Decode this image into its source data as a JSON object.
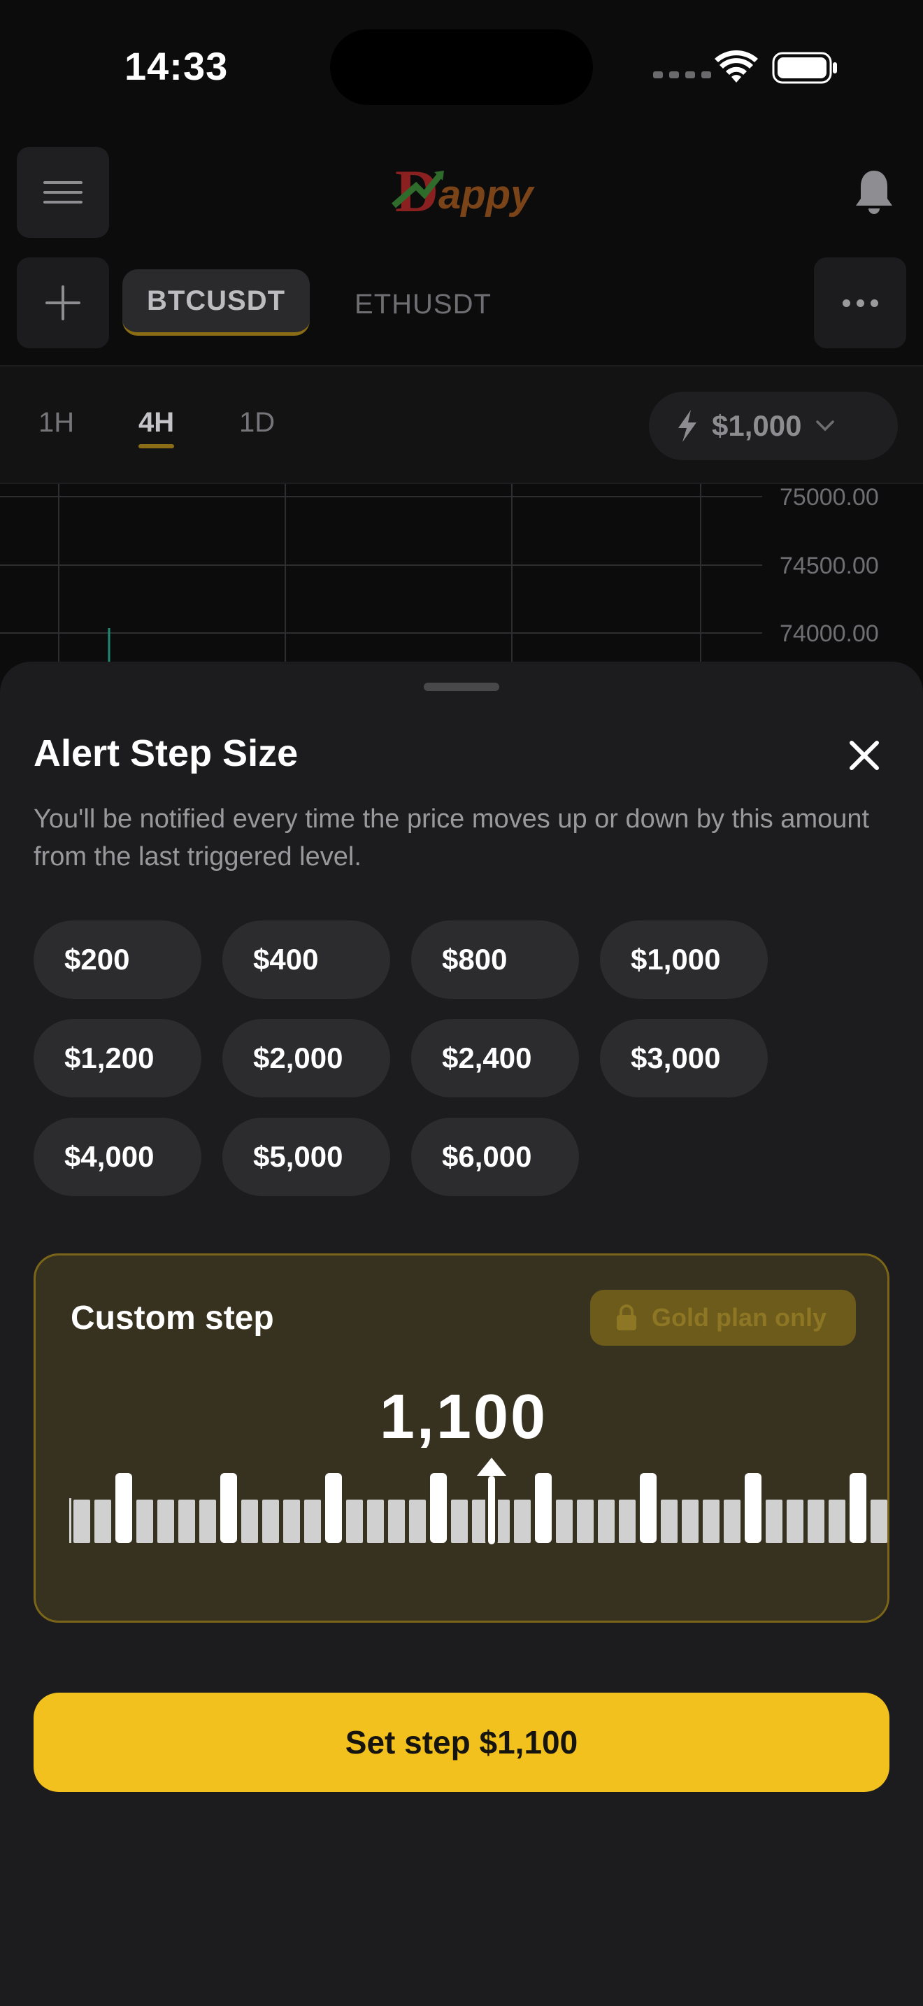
{
  "status_bar": {
    "time": "14:33"
  },
  "header": {
    "logo_text": "Dappy",
    "menu_icon": "hamburger-icon",
    "notification_icon": "bell-icon"
  },
  "symbol_tabs": {
    "add_icon": "plus-icon",
    "tabs": [
      "BTCUSDT",
      "ETHUSDT"
    ],
    "selected": "BTCUSDT",
    "more_icon": "ellipsis-icon"
  },
  "timeframes": {
    "items": [
      "1H",
      "4H",
      "1D"
    ],
    "selected": "4H",
    "alert_step": "$1,000",
    "lightning_icon": "lightning-icon",
    "chevron_icon": "chevron-down-icon"
  },
  "chart": {
    "price_labels": [
      "75000.00",
      "74500.00",
      "74000.00"
    ]
  },
  "sheet": {
    "title": "Alert Step Size",
    "close_icon": "close-icon",
    "description": "You'll be notified every time the price moves up or down by this amount from the last triggered level.",
    "presets": [
      "$200",
      "$400",
      "$800",
      "$1,000",
      "$1,200",
      "$2,000",
      "$2,400",
      "$3,000",
      "$4,000",
      "$5,000",
      "$6,000"
    ],
    "custom": {
      "label": "Custom step",
      "badge": "Gold plan only",
      "lock_icon": "lock-icon",
      "value": "1,100",
      "ruler_pointer_icon": "triangle-up-icon"
    },
    "confirm_label": "Set step $1,100"
  },
  "colors": {
    "accent": "#f2c11d",
    "sheet_bg": "#1c1c1e",
    "chip_bg": "#2c2c2e",
    "custom_bg": "#37311f",
    "custom_border": "#7a6518"
  }
}
